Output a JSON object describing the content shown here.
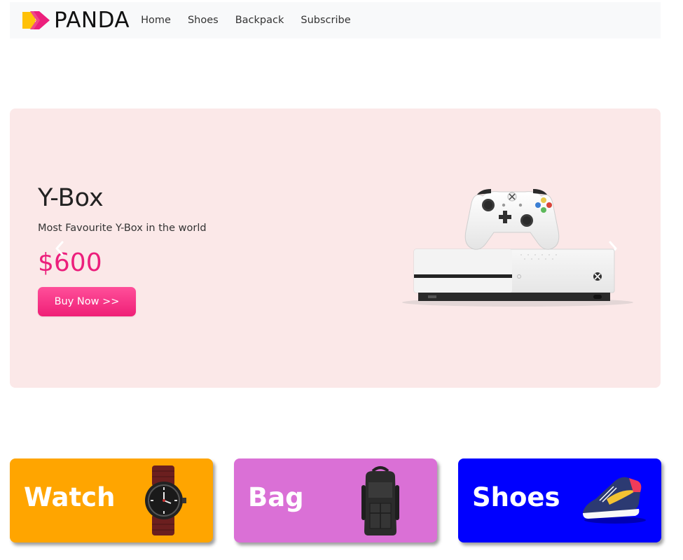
{
  "navbar": {
    "brand": "PANDA",
    "links": [
      "Home",
      "Shoes",
      "Backpack",
      "Subscribe"
    ],
    "logo_colors": [
      "#ffc107",
      "#ec1f7c"
    ],
    "background": "#f8f9fa"
  },
  "hero": {
    "title": "Y-Box",
    "subtitle": "Most Favourite Y-Box in the world",
    "price": "$600",
    "button_label": "Buy Now >>",
    "prev_icon": "chevron-left-icon",
    "next_icon": "chevron-right-icon",
    "background": "#fbe8e8",
    "accent": "#ec1f7c"
  },
  "categories": [
    {
      "label": "Watch",
      "color": "#ffa500",
      "icon": "wristwatch-image"
    },
    {
      "label": "Bag",
      "color": "#da70d6",
      "icon": "backpack-image"
    },
    {
      "label": "Shoes",
      "color": "#0000ff",
      "icon": "sneaker-image"
    }
  ]
}
